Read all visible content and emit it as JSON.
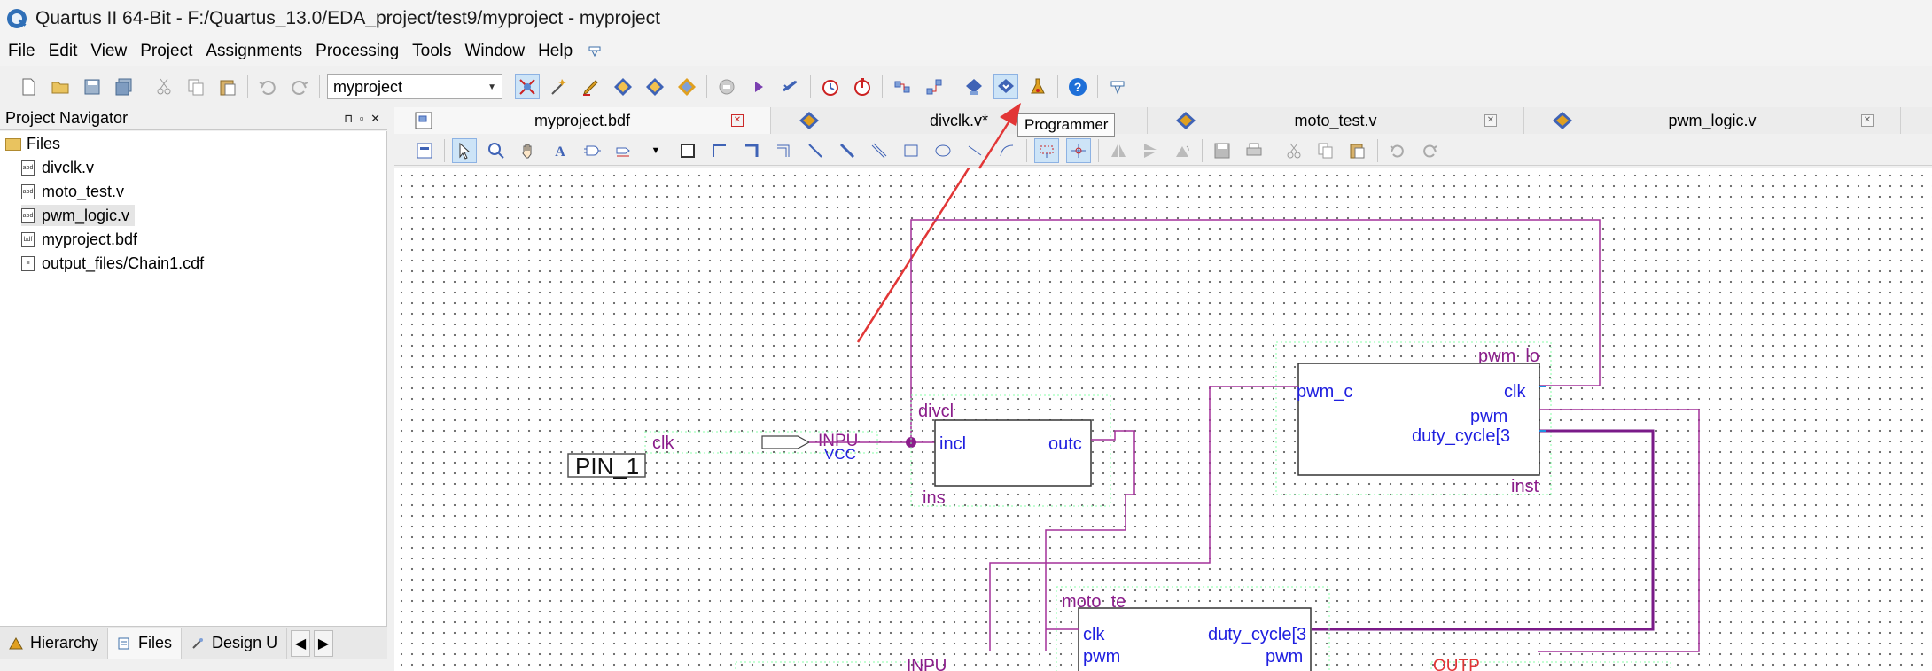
{
  "window": {
    "title": "Quartus II 64-Bit - F:/Quartus_13.0/EDA_project/test9/myproject - myproject"
  },
  "menu": [
    "File",
    "Edit",
    "View",
    "Project",
    "Assignments",
    "Processing",
    "Tools",
    "Window",
    "Help"
  ],
  "toolbar": {
    "project_select": "myproject",
    "tooltip": "Programmer"
  },
  "navigator": {
    "title": "Project Navigator",
    "root": "Files",
    "files": [
      "divclk.v",
      "moto_test.v",
      "pwm_logic.v",
      "myproject.bdf",
      "output_files/Chain1.cdf"
    ],
    "tabs": [
      "Hierarchy",
      "Files",
      "Design U"
    ]
  },
  "doc_tabs": [
    "myproject.bdf",
    "divclk.v*",
    "moto_test.v",
    "pwm_logic.v"
  ],
  "schematic": {
    "pin_label": "PIN_1",
    "input_name": "clk",
    "input_text": "INPU",
    "vcc_text": "VCC",
    "divclk": {
      "name": "divcl",
      "port_in": "incl",
      "port_out": "outc",
      "inst": "ins"
    },
    "pwm": {
      "name": "pwm_lo",
      "port_a": "pwm_c",
      "port_clk": "clk",
      "port_pwm": "pwm",
      "port_duty": "duty_cycle[3",
      "inst": "inst"
    },
    "moto": {
      "name": "moto_te",
      "port_clk": "clk",
      "port_pwm": "pwm",
      "port_duty": "duty_cycle[3",
      "port_pwm_out": "pwm"
    },
    "output_text": "OUTP",
    "bottom_input_text": "INPU"
  },
  "colors": {
    "wire": "#a3309a",
    "port": "#1f1fe0",
    "block_label": "#8b1d8b",
    "bus": "#7a1a88",
    "arrow": "#e23636"
  }
}
